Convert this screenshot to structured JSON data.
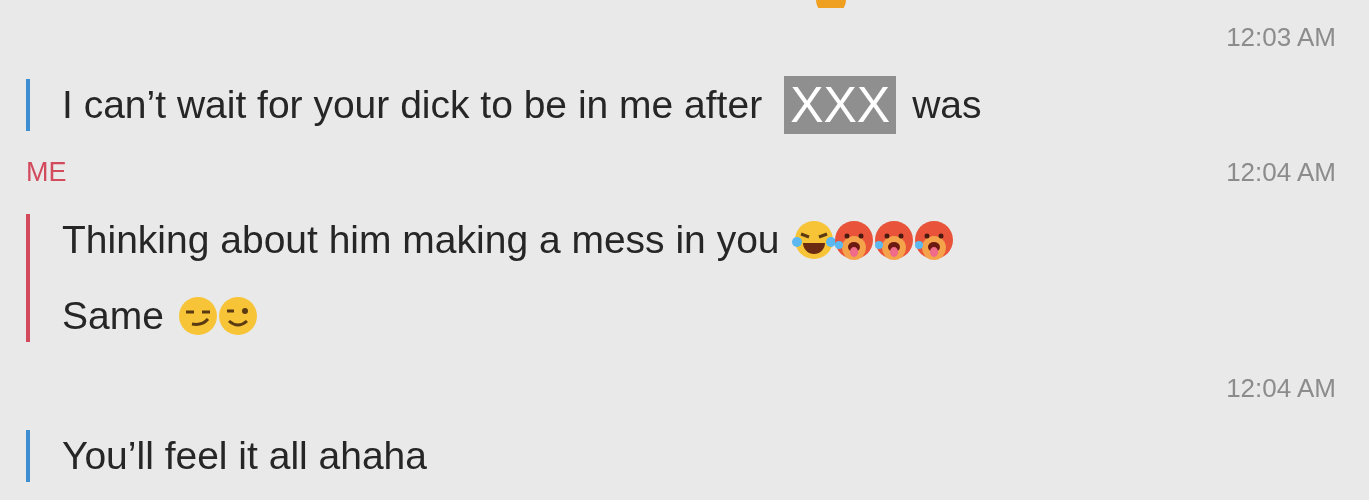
{
  "groups": [
    {
      "time": "12:03 AM",
      "color": "#3d8fd1",
      "lines": [
        [
          {
            "kind": "text",
            "text": "I can’t wait for your dick to be in me after"
          },
          {
            "kind": "redaction",
            "text": "XXX"
          },
          {
            "kind": "text",
            "text": "was"
          }
        ]
      ]
    },
    {
      "sender": "ME",
      "time": "12:04 AM",
      "color": "#d24a5c",
      "lines": [
        [
          {
            "kind": "text",
            "text": "Thinking about him making a mess in you"
          },
          {
            "kind": "laugh"
          },
          {
            "kind": "hot"
          },
          {
            "kind": "hot"
          },
          {
            "kind": "hot"
          }
        ],
        [
          {
            "kind": "text",
            "text": "Same"
          },
          {
            "kind": "smirk"
          },
          {
            "kind": "wink"
          }
        ]
      ]
    },
    {
      "time": "12:04 AM",
      "color": "#3d8fd1",
      "lines": [
        [
          {
            "kind": "text",
            "text": "You’ll feel it all ahaha"
          }
        ]
      ]
    }
  ]
}
